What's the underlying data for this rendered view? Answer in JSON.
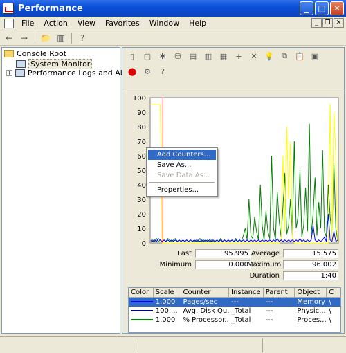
{
  "window": {
    "title": "Performance"
  },
  "menu": [
    "File",
    "Action",
    "View",
    "Favorites",
    "Window",
    "Help"
  ],
  "tree": {
    "root": "Console Root",
    "system_monitor": "System Monitor",
    "perf_logs": "Performance Logs and Alerts"
  },
  "stats": {
    "last_label": "Last",
    "last": "95.995",
    "average_label": "Average",
    "average": "15.575",
    "minimum_label": "Minimum",
    "minimum": "0.000",
    "maximum_label": "Maximum",
    "maximum": "96.002",
    "duration_label": "Duration",
    "duration": "1:40"
  },
  "legend": {
    "headers": [
      "Color",
      "Scale",
      "Counter",
      "Instance",
      "Parent",
      "Object",
      "C"
    ],
    "rows": [
      {
        "color": "#0000ff",
        "scale": "1.000",
        "counter": "Pages/sec",
        "instance": "---",
        "parent": "---",
        "object": "Memory",
        "c": "\\"
      },
      {
        "color": "#000080",
        "scale": "100....",
        "counter": "Avg. Disk Qu...",
        "instance": "_Total",
        "parent": "---",
        "object": "Physic...",
        "c": "\\"
      },
      {
        "color": "#008000",
        "scale": "1.000",
        "counter": "% Processor...",
        "instance": "_Total",
        "parent": "---",
        "object": "Proces...",
        "c": "\\"
      }
    ]
  },
  "context_menu": {
    "add_counters": "Add Counters...",
    "save_as": "Save As...",
    "save_data_as": "Save Data As...",
    "properties": "Properties..."
  },
  "chart_data": {
    "type": "line",
    "ylim": [
      0,
      100
    ],
    "yticks": [
      "100",
      "90",
      "80",
      "70",
      "60",
      "50",
      "40",
      "30",
      "20",
      "10",
      "0"
    ],
    "series": [
      {
        "color": "#008000",
        "values": [
          1,
          2,
          1,
          3,
          1,
          2,
          1,
          2,
          1,
          3,
          2,
          1,
          2,
          3,
          1,
          2,
          1,
          2,
          1,
          2,
          1,
          2,
          1,
          1,
          2,
          1,
          3,
          1,
          2,
          1,
          2,
          1,
          2,
          1,
          1,
          2,
          1,
          3,
          1,
          2,
          1,
          2,
          1,
          2,
          1,
          3,
          1,
          2,
          1,
          5,
          10,
          2,
          30,
          5,
          3,
          18,
          8,
          2,
          40,
          12,
          2,
          22,
          8,
          3,
          60,
          10,
          2,
          35,
          15,
          4,
          25,
          48,
          6,
          12,
          30,
          5,
          70,
          10,
          18,
          50,
          4,
          12,
          38,
          8,
          82,
          6,
          20,
          45,
          5,
          28,
          10,
          64,
          8,
          4,
          40,
          18,
          6,
          55,
          10,
          2
        ]
      },
      {
        "color": "#ffff00",
        "values": [
          95,
          95,
          95,
          95,
          95,
          95,
          0,
          0,
          0,
          0,
          0,
          0,
          0,
          0,
          0,
          0,
          0,
          0,
          0,
          0,
          0,
          0,
          0,
          0,
          0,
          0,
          0,
          0,
          0,
          0,
          0,
          0,
          0,
          0,
          0,
          0,
          0,
          0,
          0,
          0,
          0,
          0,
          0,
          0,
          0,
          0,
          0,
          0,
          0,
          0,
          0,
          0,
          0,
          0,
          0,
          0,
          0,
          0,
          0,
          0,
          0,
          0,
          0,
          0,
          0,
          0,
          0,
          0,
          0,
          2,
          60,
          8,
          80,
          30,
          70,
          5,
          0,
          0,
          0,
          0,
          0,
          0,
          0,
          0,
          0,
          0,
          0,
          0,
          0,
          0,
          0,
          0,
          0,
          0,
          0,
          96,
          0,
          90,
          60,
          0
        ]
      },
      {
        "color": "#0000ff",
        "values": [
          2,
          1,
          2,
          1,
          3,
          2,
          1,
          2,
          1,
          2,
          1,
          2,
          1,
          2,
          1,
          2,
          1,
          2,
          1,
          2,
          1,
          2,
          1,
          2,
          1,
          2,
          1,
          2,
          1,
          2,
          1,
          2,
          1,
          2,
          1,
          2,
          1,
          2,
          1,
          2,
          1,
          2,
          1,
          2,
          1,
          2,
          1,
          2,
          1,
          2,
          1,
          2,
          1,
          2,
          1,
          2,
          1,
          2,
          1,
          2,
          1,
          2,
          1,
          2,
          1,
          2,
          1,
          3,
          1,
          2,
          1,
          2,
          1,
          2,
          1,
          2,
          1,
          2,
          1,
          3,
          1,
          2,
          1,
          2,
          1,
          2,
          12,
          2,
          1,
          2,
          1,
          2,
          4,
          1,
          20,
          2,
          1,
          8,
          1,
          2
        ]
      }
    ],
    "cursor_color": "#ff0000"
  }
}
